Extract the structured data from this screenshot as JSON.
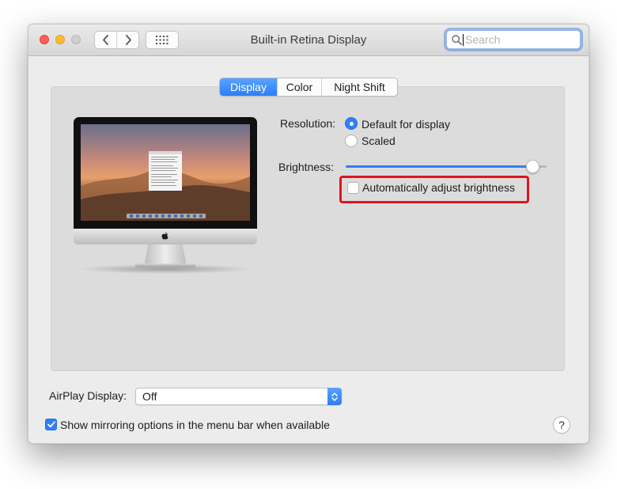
{
  "window": {
    "title": "Built-in Retina Display",
    "search": {
      "placeholder": "Search",
      "value": ""
    }
  },
  "tabs": [
    {
      "label": "Display",
      "active": true
    },
    {
      "label": "Color",
      "active": false
    },
    {
      "label": "Night Shift",
      "active": false
    }
  ],
  "display": {
    "resolution_label": "Resolution:",
    "resolution_options": [
      {
        "label": "Default for display",
        "selected": true
      },
      {
        "label": "Scaled",
        "selected": false
      }
    ],
    "brightness_label": "Brightness:",
    "brightness_level": 0.93,
    "auto_brightness": {
      "label": "Automatically adjust brightness",
      "checked": false
    }
  },
  "airplay": {
    "label": "AirPlay Display:",
    "value": "Off"
  },
  "mirroring": {
    "label": "Show mirroring options in the menu bar when available",
    "checked": true
  },
  "help_label": "?",
  "colors": {
    "accent": "#2f7ff5",
    "highlight": "#e0141b"
  },
  "icons": [
    "chevron-left-icon",
    "chevron-right-icon",
    "grid-icon",
    "search-icon",
    "apple-logo-icon",
    "chevron-updown-icon",
    "checkmark-icon"
  ]
}
